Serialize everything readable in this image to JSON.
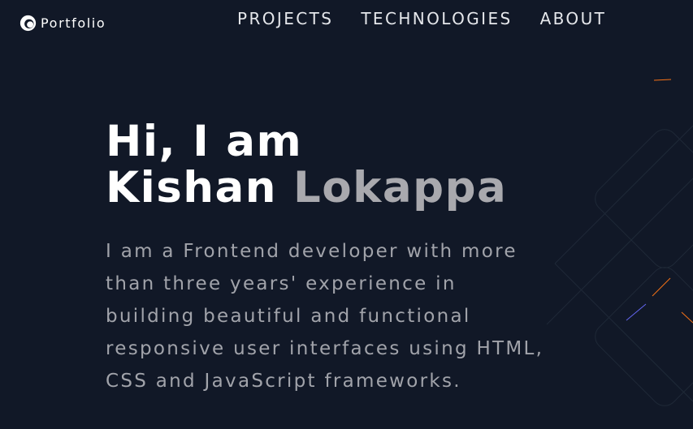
{
  "brand": {
    "name": "Portfolio",
    "icon": "portfolio-logo-icon"
  },
  "nav": {
    "items": [
      "PROJECTS",
      "TECHNOLOGIES",
      "ABOUT"
    ]
  },
  "hero": {
    "greeting": "Hi, I am",
    "first_name": "Kishan",
    "last_name": "Lokappa",
    "description": "I am a Frontend developer with more than three years' experience in building beautiful and functional responsive user interfaces using HTML, CSS and JavaScript frameworks."
  },
  "colors": {
    "background": "#111827",
    "heading": "#ffffff",
    "muted_name": "#a9a9ae",
    "body_text": "#a1a3aa",
    "accent_orange": "#f97316",
    "accent_blue": "#6366f1"
  }
}
